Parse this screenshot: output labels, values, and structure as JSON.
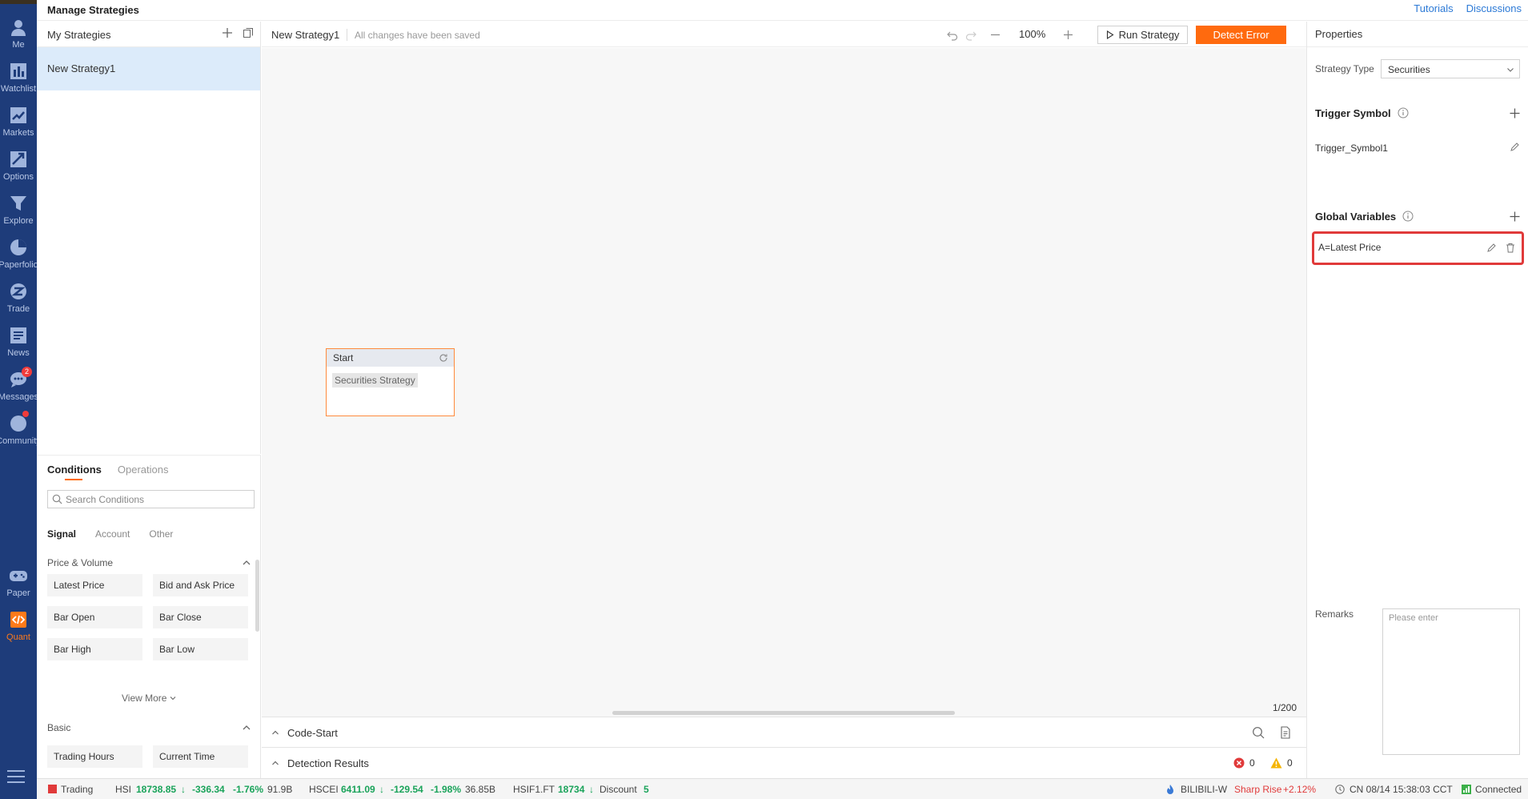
{
  "app": {
    "title": "Manage Strategies",
    "links": [
      "Tutorials",
      "Discussions"
    ]
  },
  "nav": [
    {
      "label": "Me",
      "icon": "user-icon"
    },
    {
      "label": "Watchlist",
      "icon": "bar-chart-icon"
    },
    {
      "label": "Markets",
      "icon": "trend-icon"
    },
    {
      "label": "Options",
      "icon": "options-icon"
    },
    {
      "label": "Explore",
      "icon": "funnel-icon"
    },
    {
      "label": "Paperfolio",
      "icon": "pie-icon"
    },
    {
      "label": "Trade",
      "icon": "trade-icon"
    },
    {
      "label": "News",
      "icon": "news-icon"
    },
    {
      "label": "Messages",
      "icon": "chat-icon",
      "badge": "2"
    },
    {
      "label": "Community",
      "icon": "community-icon"
    },
    {
      "label": "Paper",
      "icon": "gamepad-icon"
    },
    {
      "label": "Quant",
      "icon": "code-icon",
      "active": true
    }
  ],
  "strategies": {
    "header": "My Strategies",
    "items": [
      "New Strategy1"
    ]
  },
  "conditions": {
    "tabs": [
      "Conditions",
      "Operations"
    ],
    "search_placeholder": "Search Conditions",
    "subtabs": [
      "Signal",
      "Account",
      "Other"
    ],
    "sections": [
      {
        "title": "Price & Volume",
        "items": [
          "Latest Price",
          "Bid and Ask Price",
          "Bar Open",
          "Bar Close",
          "Bar High",
          "Bar Low"
        ],
        "more": "View More"
      },
      {
        "title": "Basic",
        "items": [
          "Trading Hours",
          "Current Time"
        ]
      }
    ]
  },
  "canvas": {
    "strategy_name": "New Strategy1",
    "save_status": "All changes have been saved",
    "zoom": "100%",
    "run_label": "Run Strategy",
    "detect_label": "Detect Error",
    "node_title": "Start",
    "node_body": "Securities Strategy",
    "page_count": "1/200",
    "code_title": "Code-Start",
    "detect_title": "Detection Results",
    "error_count": "0",
    "warning_count": "0"
  },
  "properties": {
    "header": "Properties",
    "strategy_type_label": "Strategy Type",
    "strategy_type_value": "Securities",
    "trigger_title": "Trigger Symbol",
    "trigger_item": "Trigger_Symbol1",
    "globals_title": "Global Variables",
    "global_item": "A=Latest Price",
    "remarks_label": "Remarks",
    "remarks_placeholder": "Please enter"
  },
  "status": {
    "trading": "Trading",
    "hsi_label": "HSI",
    "hsi_value": "18738.85",
    "hsi_change": "-336.34",
    "hsi_pct": "-1.76%",
    "hsi_vol": "91.9B",
    "hscei_label": "HSCEI",
    "hscei_value": "6411.09",
    "hscei_change": "-129.54",
    "hscei_pct": "-1.98%",
    "hscei_vol": "36.85B",
    "hsif_label": "HSIF1.FT",
    "hsif_value": "18734",
    "discount_label": "Discount",
    "discount_value": "5",
    "stock": "BILIBILI-W",
    "alert": "Sharp Rise",
    "alert_pct": "+2.12%",
    "time": "CN 08/14 15:38:03 CCT",
    "conn": "Connected"
  },
  "colors": {
    "rail": "#1e3c7a",
    "accent": "#ff6a0e",
    "link": "#2d7ad6",
    "highlight_border": "#e03a3a",
    "selected_bg": "#dcebfa"
  }
}
